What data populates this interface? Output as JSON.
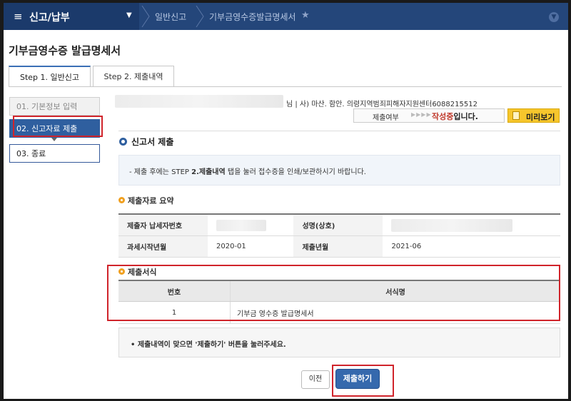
{
  "nav": {
    "menu_label": "신고/납부",
    "crumbs": [
      "일반신고",
      "기부금영수증발급명세서"
    ]
  },
  "page_title": "기부금영수증 발급명세서",
  "tabs": [
    {
      "label": "Step 1. 일반신고"
    },
    {
      "label": "Step 2. 제출내역"
    }
  ],
  "steps": [
    {
      "label": "01. 기본정보 입력"
    },
    {
      "label": "02. 신고자료 제출"
    },
    {
      "label": "03. 종료"
    }
  ],
  "header": {
    "info_text": "님 | 사) 마산. 함안. 의령지역범죄피해자지원센터6088215512",
    "status_label": "제출여부",
    "status_arrows": "▶▶▶▶",
    "status_value": "작성중",
    "status_suffix": "입니다.",
    "preview_label": "미리보기"
  },
  "submit_section": {
    "title": "신고서 제출",
    "notice_prefix": "- 제출 후에는 STEP ",
    "notice_strong": "2.제출내역",
    "notice_suffix": " 탭을 눌러 접수증을 인쇄/보관하시기 바랍니다."
  },
  "summary": {
    "title": "제출자료 요약",
    "rows": [
      {
        "label1": "제출자 납세자번호",
        "value1": "",
        "label2": "성명(상호)",
        "value2": ""
      },
      {
        "label1": "과세시작년월",
        "value1": "2020-01",
        "label2": "제출년월",
        "value2": "2021-06"
      }
    ]
  },
  "forms": {
    "title": "제출서식",
    "headers": [
      "번호",
      "서식명"
    ],
    "rows": [
      {
        "no": "1",
        "name": "기부금 영수증 발급명세서"
      }
    ]
  },
  "bottom_notice": "• 제출내역이 맞으면 '제출하기' 버튼을 눌러주세요.",
  "buttons": {
    "prev": "이전",
    "submit": "제출하기"
  },
  "colors": {
    "nav": "#1e3d6e",
    "accent": "#2f5f9f",
    "highlight": "#d0242b",
    "status": "#c0392b",
    "preview": "#f6c62c"
  }
}
